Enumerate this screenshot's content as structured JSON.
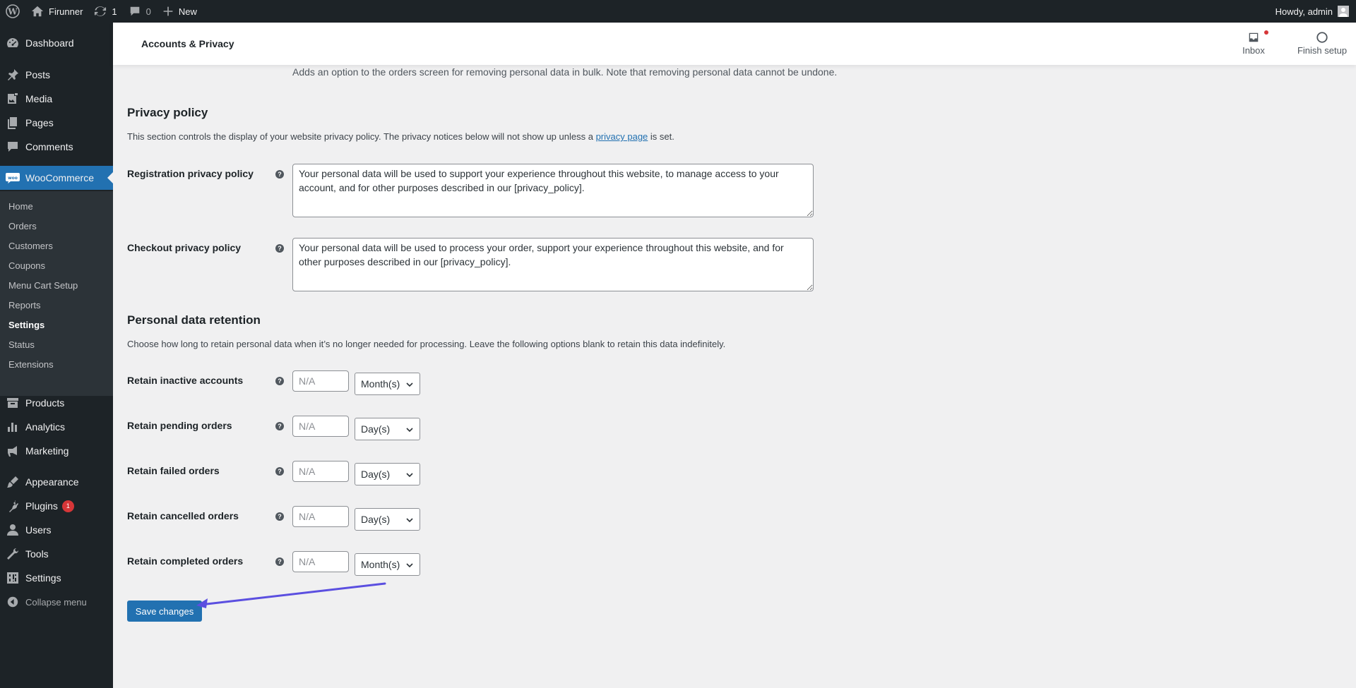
{
  "adminbar": {
    "site_name": "Firunner",
    "updates_count": "1",
    "comments_count": "0",
    "new_label": "New",
    "howdy": "Howdy, admin"
  },
  "sidebar": {
    "items": [
      {
        "label": "Dashboard",
        "icon": "dashboard-icon"
      },
      {
        "label": "Posts",
        "icon": "pin-icon"
      },
      {
        "label": "Media",
        "icon": "media-icon"
      },
      {
        "label": "Pages",
        "icon": "pages-icon"
      },
      {
        "label": "Comments",
        "icon": "comment-icon"
      },
      {
        "label": "WooCommerce",
        "icon": "woo-icon"
      },
      {
        "label": "Products",
        "icon": "archive-icon"
      },
      {
        "label": "Analytics",
        "icon": "bar-chart-icon"
      },
      {
        "label": "Marketing",
        "icon": "megaphone-icon"
      },
      {
        "label": "Appearance",
        "icon": "brush-icon"
      },
      {
        "label": "Plugins",
        "icon": "plugin-icon",
        "badge": "1"
      },
      {
        "label": "Users",
        "icon": "user-icon"
      },
      {
        "label": "Tools",
        "icon": "wrench-icon"
      },
      {
        "label": "Settings",
        "icon": "settings-icon"
      }
    ],
    "woo_submenu": [
      "Home",
      "Orders",
      "Customers",
      "Coupons",
      "Menu Cart Setup",
      "Reports",
      "Settings",
      "Status",
      "Extensions"
    ],
    "collapse_label": "Collapse menu"
  },
  "header": {
    "title": "Accounts & Privacy",
    "inbox_label": "Inbox",
    "finish_setup_label": "Finish setup"
  },
  "content": {
    "bulk_note": "Adds an option to the orders screen for removing personal data in bulk. Note that removing personal data cannot be undone.",
    "privacy_policy": {
      "heading": "Privacy policy",
      "desc_before": "This section controls the display of your website privacy policy. The privacy notices below will not show up unless a",
      "desc_link": "privacy page",
      "desc_after": "is set.",
      "registration_label": "Registration privacy policy",
      "registration_text": "Your personal data will be used to support your experience throughout this website, to manage access to your account, and for other purposes described in our [privacy_policy].",
      "checkout_label": "Checkout privacy policy",
      "checkout_text": "Your personal data will be used to process your order, support your experience throughout this website, and for other purposes described in our [privacy_policy]."
    },
    "retention": {
      "heading": "Personal data retention",
      "desc": "Choose how long to retain personal data when it’s no longer needed for processing. Leave the following options blank to retain this data indefinitely.",
      "placeholder": "N/A",
      "rows": [
        {
          "label": "Retain inactive accounts",
          "unit": "Month(s)"
        },
        {
          "label": "Retain pending orders",
          "unit": "Day(s)"
        },
        {
          "label": "Retain failed orders",
          "unit": "Day(s)"
        },
        {
          "label": "Retain cancelled orders",
          "unit": "Day(s)"
        },
        {
          "label": "Retain completed orders",
          "unit": "Month(s)"
        }
      ]
    },
    "help_glyph": "?",
    "save_label": "Save changes"
  },
  "colors": {
    "accent": "#2271b1",
    "admin_dark": "#1d2327",
    "arrow": "#5b4fe0",
    "badge": "#d63638"
  }
}
